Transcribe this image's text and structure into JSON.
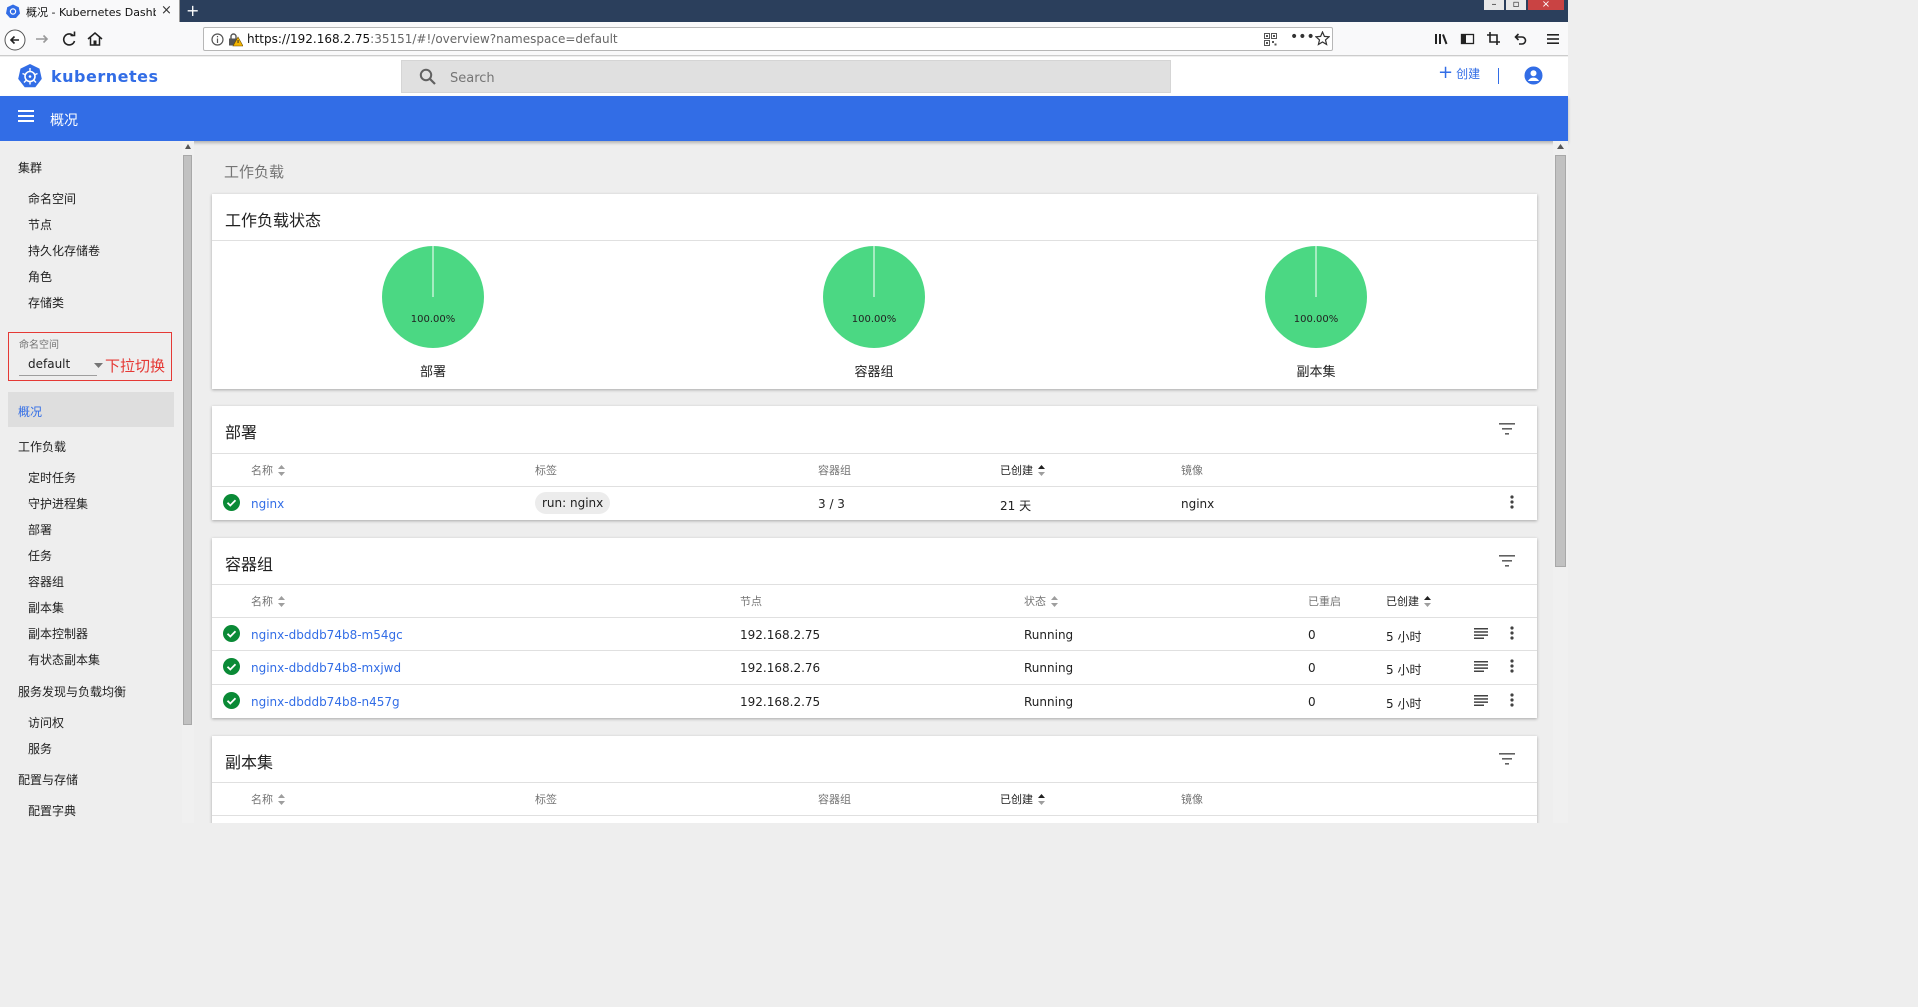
{
  "browser": {
    "tab_title": "概况 - Kubernetes Dashboard",
    "url_host": "https://192.168.2.75",
    "url_rest": ":35151/#!/overview?namespace=default"
  },
  "header": {
    "brand": "kubernetes",
    "search_placeholder": "Search",
    "create_label": "创建"
  },
  "toolbar": {
    "title": "概况"
  },
  "sidebar": {
    "cluster_heading": "集群",
    "cluster_items": [
      "命名空间",
      "节点",
      "持久化存储卷",
      "角色",
      "存储类"
    ],
    "namespace_label": "命名空间",
    "namespace_value": "default",
    "namespace_annotation": "下拉切换",
    "active_item": "概况",
    "workload_heading": "工作负载",
    "workload_items": [
      "定时任务",
      "守护进程集",
      "部署",
      "任务",
      "容器组",
      "副本集",
      "副本控制器",
      "有状态副本集"
    ],
    "discovery_heading": "服务发现与负载均衡",
    "discovery_items": [
      "访问权",
      "服务"
    ],
    "config_heading": "配置与存储",
    "config_items": [
      "配置字典"
    ]
  },
  "main": {
    "section_title": "工作负载",
    "status_card": {
      "title": "工作负载状态",
      "charts": [
        {
          "label": "部署",
          "percent_text": "100.00%",
          "running_fraction": 1.0
        },
        {
          "label": "容器组",
          "percent_text": "100.00%",
          "running_fraction": 1.0
        },
        {
          "label": "副本集",
          "percent_text": "100.00%",
          "running_fraction": 1.0
        }
      ]
    },
    "deployments": {
      "title": "部署",
      "headers": {
        "name": "名称",
        "labels": "标签",
        "pods": "容器组",
        "created": "已创建",
        "image": "镜像"
      },
      "rows": [
        {
          "name": "nginx",
          "labels": "run: nginx",
          "pods": "3 / 3",
          "created": "21 天",
          "image": "nginx"
        }
      ]
    },
    "pods": {
      "title": "容器组",
      "headers": {
        "name": "名称",
        "node": "节点",
        "status": "状态",
        "restarts": "已重启",
        "created": "已创建"
      },
      "rows": [
        {
          "name": "nginx-dbddb74b8-m54gc",
          "node": "192.168.2.75",
          "status": "Running",
          "restarts": "0",
          "created": "5 小时"
        },
        {
          "name": "nginx-dbddb74b8-mxjwd",
          "node": "192.168.2.76",
          "status": "Running",
          "restarts": "0",
          "created": "5 小时"
        },
        {
          "name": "nginx-dbddb74b8-n457g",
          "node": "192.168.2.75",
          "status": "Running",
          "restarts": "0",
          "created": "5 小时"
        }
      ]
    },
    "replicasets": {
      "title": "副本集",
      "headers": {
        "name": "名称",
        "labels": "标签",
        "pods": "容器组",
        "created": "已创建",
        "image": "镜像"
      }
    }
  },
  "colors": {
    "brand_blue": "#326de6",
    "pie_green": "#4bd883",
    "ok_green": "#0a8a36",
    "annotation_red": "#e53935"
  }
}
